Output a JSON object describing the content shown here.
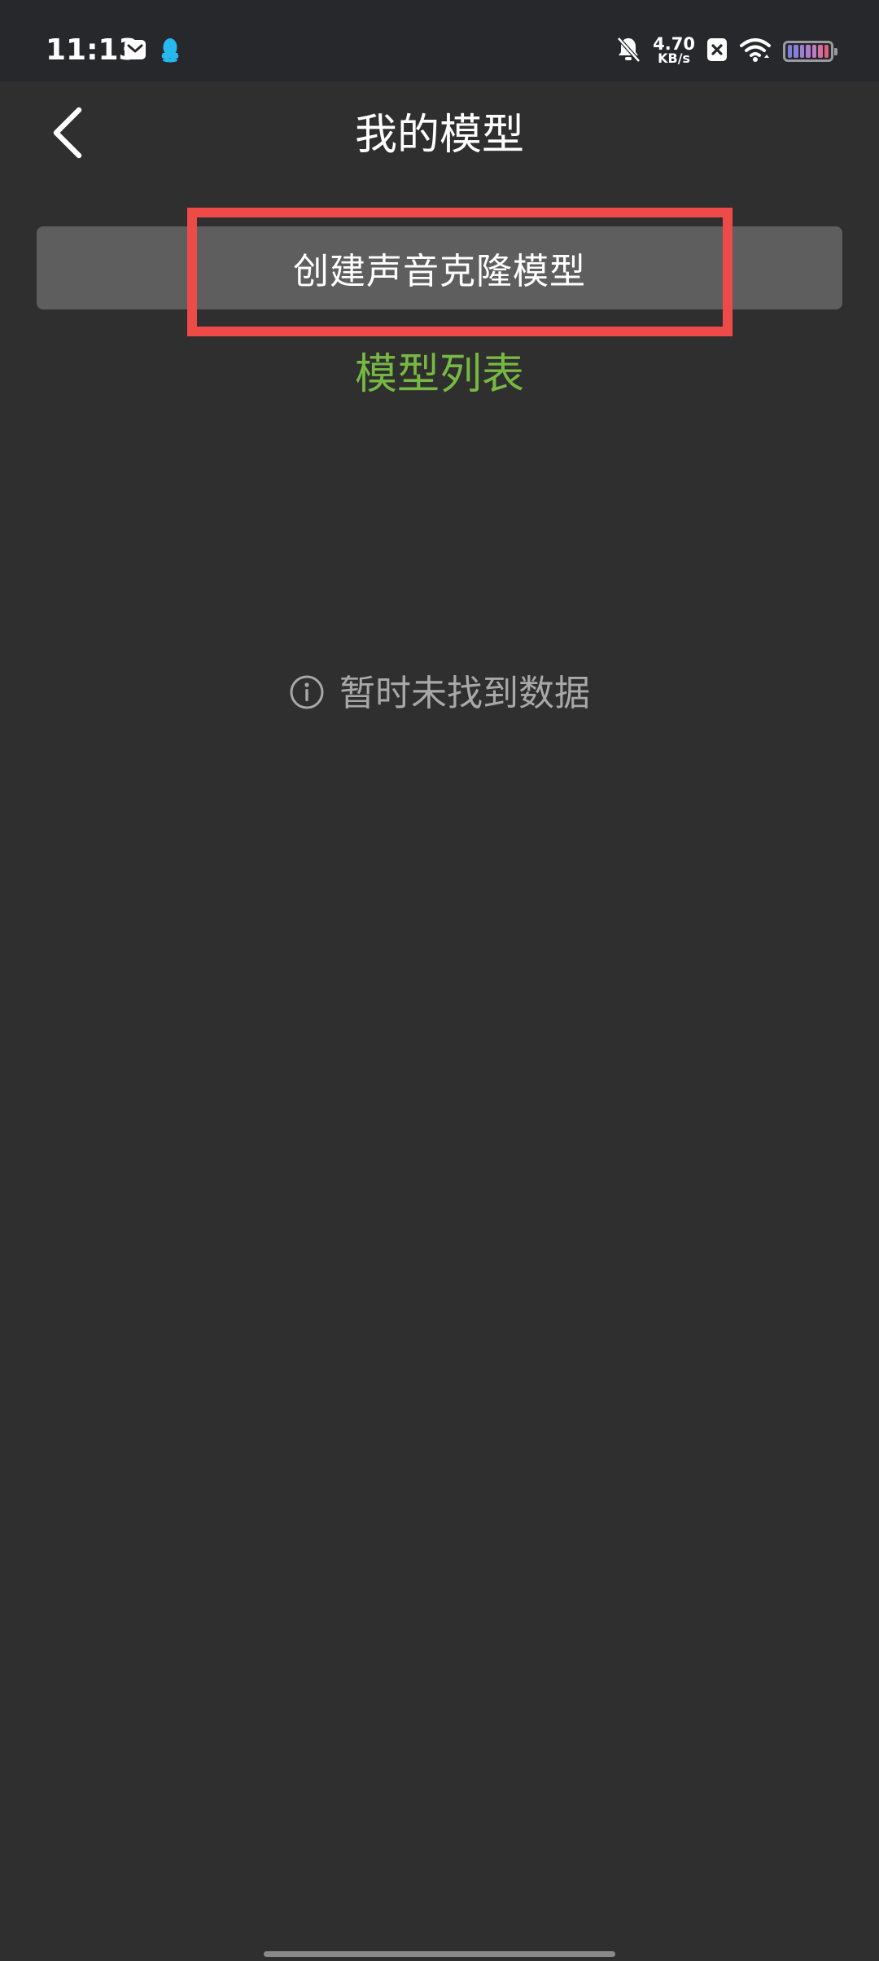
{
  "status_bar": {
    "time": "11:13",
    "net_speed_value": "4.70",
    "net_speed_unit": "KB/s",
    "icons": [
      "mail-icon",
      "qq-penguin-icon",
      "bell-off-icon",
      "close-box-icon",
      "wifi-icon",
      "battery-icon"
    ],
    "battery_cell_colors": [
      "#7a7fd8",
      "#8a7fd6",
      "#9b7fd1",
      "#ad7ccb",
      "#c07ac0",
      "#d26f9e",
      "#dc5f7c"
    ]
  },
  "header": {
    "back_icon": "chevron-left-icon",
    "title": "我的模型"
  },
  "create_button": {
    "label": "创建声音克隆模型"
  },
  "model_list": {
    "title": "模型列表",
    "empty_icon": "info-circle-icon",
    "empty_text": "暂时未找到数据"
  },
  "colors": {
    "background": "#2f2f2f",
    "status_bar_bg": "#27282c",
    "button_bg": "#5e5e5f",
    "highlight": "#ee4a48",
    "accent_green": "#77b843",
    "empty_text": "#a8a8a8",
    "qq_icon": "#26b8ef"
  }
}
